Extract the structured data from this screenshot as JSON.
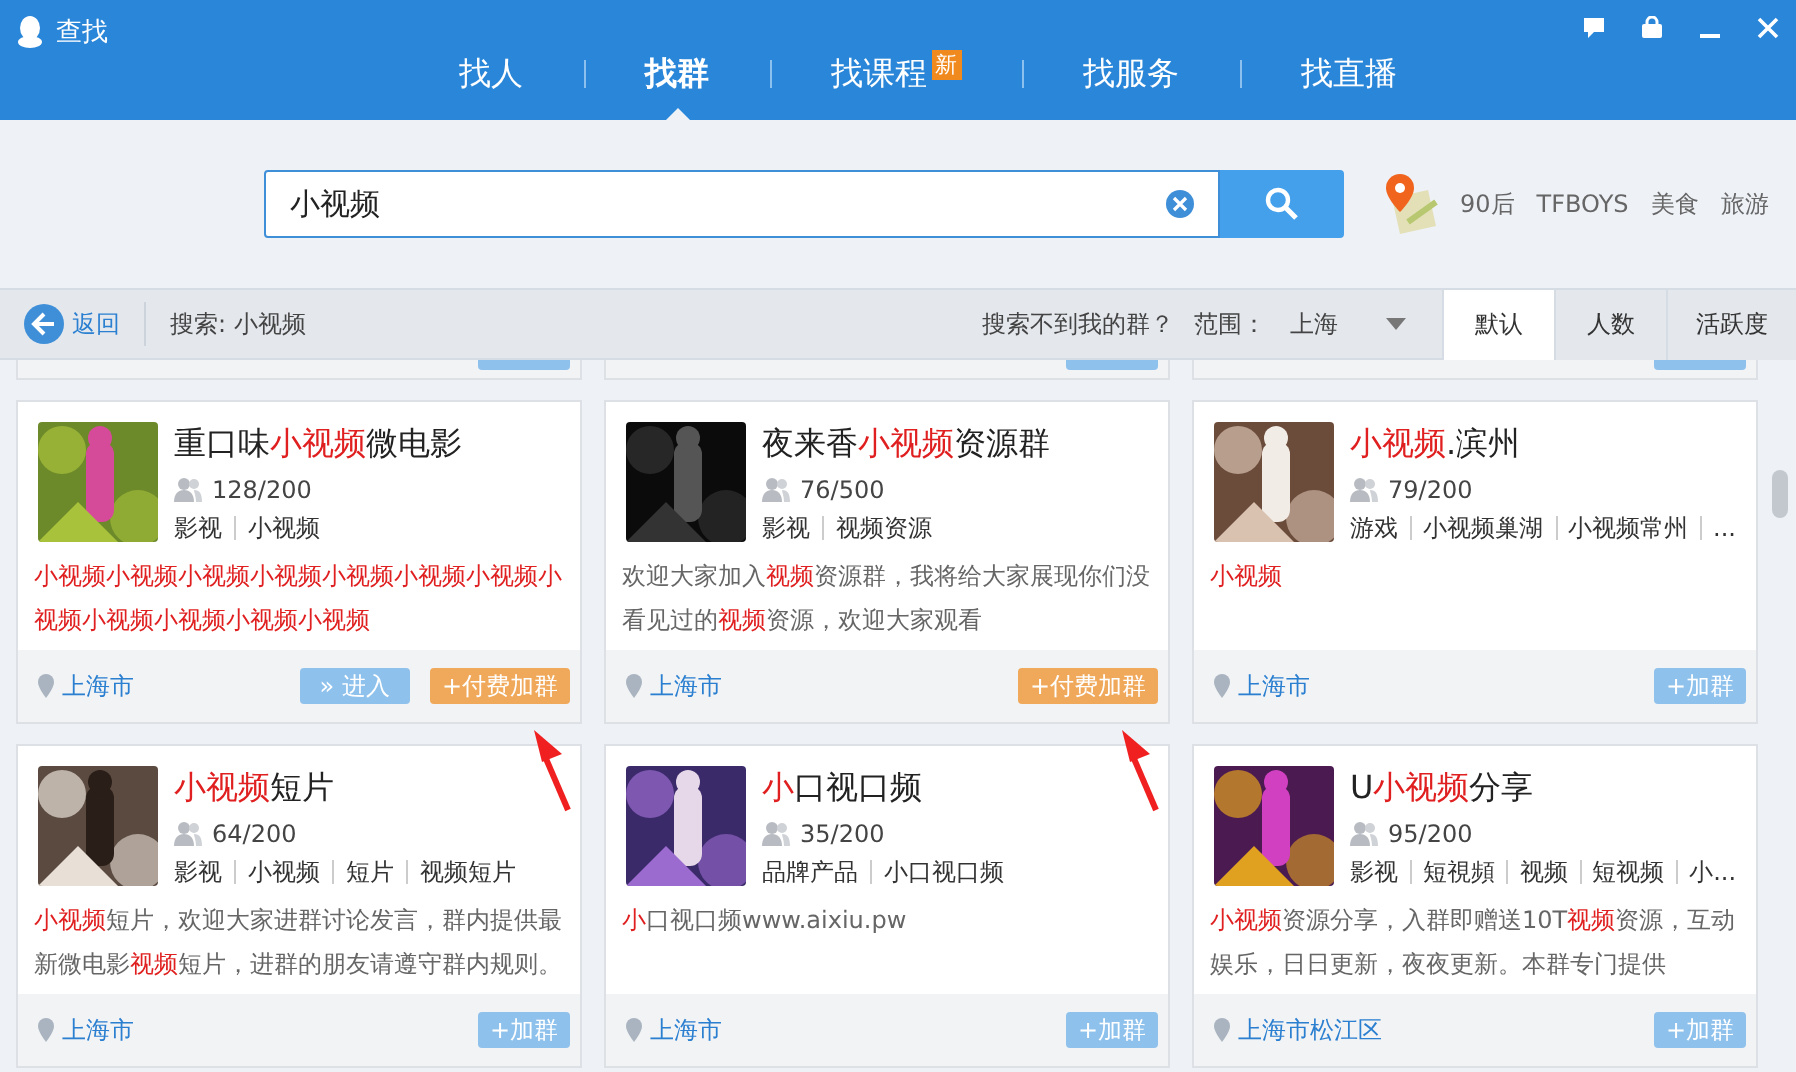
{
  "window": {
    "title": "查找"
  },
  "tabs": [
    {
      "label": "找人",
      "selected": false
    },
    {
      "label": "找群",
      "selected": true
    },
    {
      "label": "找课程",
      "selected": false,
      "badge": "新"
    },
    {
      "label": "找服务",
      "selected": false
    },
    {
      "label": "找直播",
      "selected": false
    }
  ],
  "search": {
    "value": "小视频"
  },
  "hot_words": [
    "90后",
    "TFBOYS",
    "美食",
    "旅游"
  ],
  "toolbar": {
    "back": "返回",
    "query": "搜索: 小视频",
    "not_found": "搜索不到我的群？",
    "range_label": "范围：",
    "range_value": "上海"
  },
  "sort_tabs": [
    {
      "label": "默认",
      "selected": true
    },
    {
      "label": "人数",
      "selected": false
    },
    {
      "label": "活跃度",
      "selected": false
    }
  ],
  "groups": [
    {
      "title": [
        {
          "text": "重口味",
          "hl": false
        },
        {
          "text": "小视频",
          "hl": true
        },
        {
          "text": "微电影",
          "hl": false
        }
      ],
      "members": "128/200",
      "tags": [
        "影视",
        "小视频"
      ],
      "description": [
        {
          "text": "小视频小视频小视频小视频小视频小视频小视频小视频小视频小视频小视频小视频",
          "hl": true
        }
      ],
      "location": "上海市",
      "buttons": [
        {
          "kind": "enter",
          "label": "» 进入"
        },
        {
          "kind": "paid",
          "label": "+付费加群"
        }
      ],
      "arrow": true
    },
    {
      "title": [
        {
          "text": "夜来香",
          "hl": false
        },
        {
          "text": "小视频",
          "hl": true
        },
        {
          "text": "资源群",
          "hl": false
        }
      ],
      "members": "76/500",
      "tags": [
        "影视",
        "视频资源"
      ],
      "description": [
        {
          "text": "欢迎大家加入",
          "hl": false
        },
        {
          "text": "视频",
          "hl": true
        },
        {
          "text": "资源群，我将给大家展现你们没看见过的",
          "hl": false
        },
        {
          "text": "视频",
          "hl": true
        },
        {
          "text": "资源，欢迎大家观看",
          "hl": false
        }
      ],
      "location": "上海市",
      "buttons": [
        {
          "kind": "paid",
          "label": "+付费加群"
        }
      ],
      "arrow": true
    },
    {
      "title": [
        {
          "text": "小视频",
          "hl": true
        },
        {
          "text": ".滨州",
          "hl": false
        }
      ],
      "members": "79/200",
      "tags": [
        "游戏",
        "小视频巢湖",
        "小视频常州",
        "..."
      ],
      "description": [
        {
          "text": "小视频",
          "hl": true
        }
      ],
      "location": "上海市",
      "buttons": [
        {
          "kind": "join",
          "label": "+加群"
        }
      ],
      "arrow": false
    },
    {
      "title": [
        {
          "text": "小视频",
          "hl": true
        },
        {
          "text": "短片",
          "hl": false
        }
      ],
      "members": "64/200",
      "tags": [
        "影视",
        "小视频",
        "短片",
        "视频短片"
      ],
      "description": [
        {
          "text": "小视频",
          "hl": true
        },
        {
          "text": "短片，欢迎大家进群讨论发言，群内提供最新微电影",
          "hl": false
        },
        {
          "text": "视频",
          "hl": true
        },
        {
          "text": "短片，进群的朋友请遵守群内规则。",
          "hl": false
        }
      ],
      "location": "上海市",
      "buttons": [
        {
          "kind": "join",
          "label": "+加群"
        }
      ],
      "arrow": false
    },
    {
      "title": [
        {
          "text": "小",
          "hl": true
        },
        {
          "text": "口视口频",
          "hl": false
        }
      ],
      "members": "35/200",
      "tags": [
        "品牌产品",
        "小口视口频"
      ],
      "description": [
        {
          "text": "小",
          "hl": true
        },
        {
          "text": "口视口频www.aixiu.pw",
          "hl": false
        }
      ],
      "location": "上海市",
      "buttons": [
        {
          "kind": "join",
          "label": "+加群"
        }
      ],
      "arrow": false
    },
    {
      "title": [
        {
          "text": "U",
          "hl": false
        },
        {
          "text": "小视频",
          "hl": true
        },
        {
          "text": "分享",
          "hl": false
        }
      ],
      "members": "95/200",
      "tags": [
        "影视",
        "短視頻",
        "视频",
        "短视频",
        "小..."
      ],
      "description": [
        {
          "text": "小视频",
          "hl": true
        },
        {
          "text": "资源分享，入群即赠送10T",
          "hl": false
        },
        {
          "text": "视频",
          "hl": true
        },
        {
          "text": "资源，互动娱乐，日日更新，夜夜更新。本群专门提供",
          "hl": false
        }
      ],
      "location": "上海市松江区",
      "buttons": [
        {
          "kind": "join",
          "label": "+加群"
        }
      ],
      "arrow": false
    }
  ]
}
